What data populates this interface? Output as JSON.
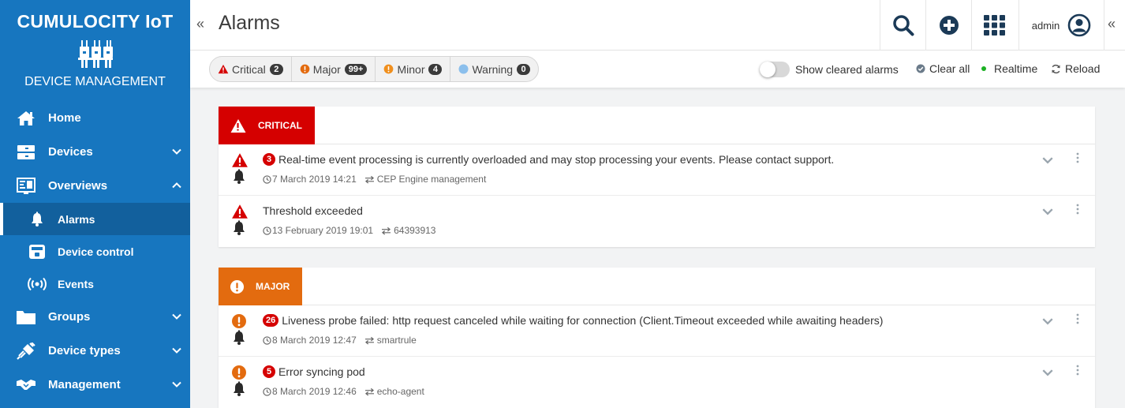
{
  "app": {
    "brand": "CUMULOCITY IoT",
    "subtitle": "DEVICE MANAGEMENT"
  },
  "colors": {
    "sidebar": "#1776bf",
    "sidebar_active": "#12609d",
    "critical": "#d50000",
    "major": "#e36b0f",
    "minor": "#f08f1d",
    "warning": "#8bbfec"
  },
  "sidebar": {
    "items": [
      {
        "label": "Home",
        "icon": "home-icon"
      },
      {
        "label": "Devices",
        "icon": "devices-icon",
        "chevron": "down"
      },
      {
        "label": "Overviews",
        "icon": "overviews-icon",
        "chevron": "up"
      },
      {
        "label": "Alarms",
        "icon": "bell-icon",
        "sub": true,
        "active": true
      },
      {
        "label": "Device control",
        "icon": "device-control-icon",
        "sub": true
      },
      {
        "label": "Events",
        "icon": "events-icon",
        "sub": true
      },
      {
        "label": "Groups",
        "icon": "folder-icon",
        "chevron": "down"
      },
      {
        "label": "Device types",
        "icon": "plug-icon",
        "chevron": "down"
      },
      {
        "label": "Management",
        "icon": "handshake-icon",
        "chevron": "down"
      }
    ]
  },
  "header": {
    "collapse_left": "«",
    "title": "Alarms",
    "user": "admin",
    "collapse_right": "«",
    "buttons": [
      "search-icon",
      "add-icon",
      "app-switcher-icon"
    ]
  },
  "filters": [
    {
      "label": "Critical",
      "count": "2",
      "icon": "critical-icon"
    },
    {
      "label": "Major",
      "count": "99+",
      "icon": "major-icon"
    },
    {
      "label": "Minor",
      "count": "4",
      "icon": "minor-icon"
    },
    {
      "label": "Warning",
      "count": "0",
      "icon": "warning-icon"
    }
  ],
  "actions": {
    "show_cleared": "Show cleared alarms",
    "show_cleared_on": false,
    "clear_all": "Clear all",
    "realtime": "Realtime",
    "reload": "Reload"
  },
  "sections": [
    {
      "label": "CRITICAL",
      "alarms": [
        {
          "count": "3",
          "text": "Real-time event processing is currently overloaded and may stop processing your events. Please contact support.",
          "time": "7 March 2019 14:21",
          "source": "CEP Engine management"
        },
        {
          "count": "",
          "text": "Threshold exceeded",
          "time": "13 February 2019 19:01",
          "source": "64393913"
        }
      ]
    },
    {
      "label": "MAJOR",
      "alarms": [
        {
          "count": "26",
          "text": "Liveness probe failed: http request canceled while waiting for connection (Client.Timeout exceeded while awaiting headers)",
          "time": "8 March 2019 12:47",
          "source": "smartrule"
        },
        {
          "count": "5",
          "text": "Error syncing pod",
          "time": "8 March 2019 12:46",
          "source": "echo-agent"
        }
      ]
    }
  ]
}
